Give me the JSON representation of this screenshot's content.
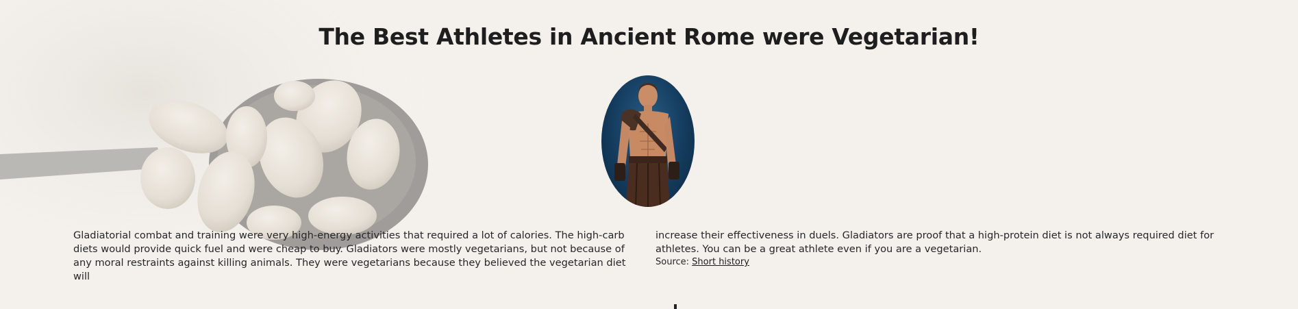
{
  "article": {
    "title": "The Best Athletes in Ancient Rome were Vegetarian!",
    "image_alt": "Gladiator portrait",
    "paragraph_left": "Gladiatorial combat and training were very high-energy activities that required a lot of calories. The high-carb diets would provide quick fuel and were cheap to buy. Gladiators were mostly vegetarians, but not because of any moral restraints against killing animals. They were vegetarians because they believed the vegetarian diet will",
    "paragraph_right": "increase their effectiveness in duels. Gladiators are proof that a high-protein diet is not always required diet for athletes. You can be a great athlete even if you are a vegetarian.",
    "source_label": "Source:",
    "source_link": "Short history"
  },
  "icons": {
    "background": "pistachio-spoon-illustration",
    "portrait": "gladiator-photo"
  }
}
